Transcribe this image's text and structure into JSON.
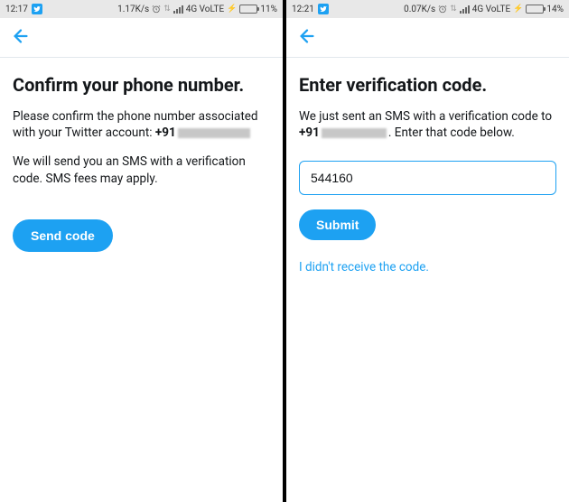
{
  "left": {
    "status": {
      "time": "12:17",
      "speed": "1.17K/s",
      "network": "4G VoLTE",
      "battery_pct": "11%",
      "battery_fill": 11
    },
    "heading": "Confirm your phone number.",
    "body1_pre": "Please confirm the phone number associated with your Twitter account: ",
    "body1_prefix": "+91",
    "body2": "We will send you an SMS with a verification code. SMS fees may apply.",
    "button": "Send code"
  },
  "right": {
    "status": {
      "time": "12:21",
      "speed": "0.07K/s",
      "network": "4G VoLTE",
      "battery_pct": "14%",
      "battery_fill": 14
    },
    "heading": "Enter verification code.",
    "body1_pre": "We just sent an SMS with a verification code to ",
    "body1_prefix": "+91",
    "body1_post": ". Enter that code below.",
    "input_value": "544160",
    "button": "Submit",
    "link": "I didn't receive the code."
  },
  "colors": {
    "accent": "#1da1f2"
  }
}
